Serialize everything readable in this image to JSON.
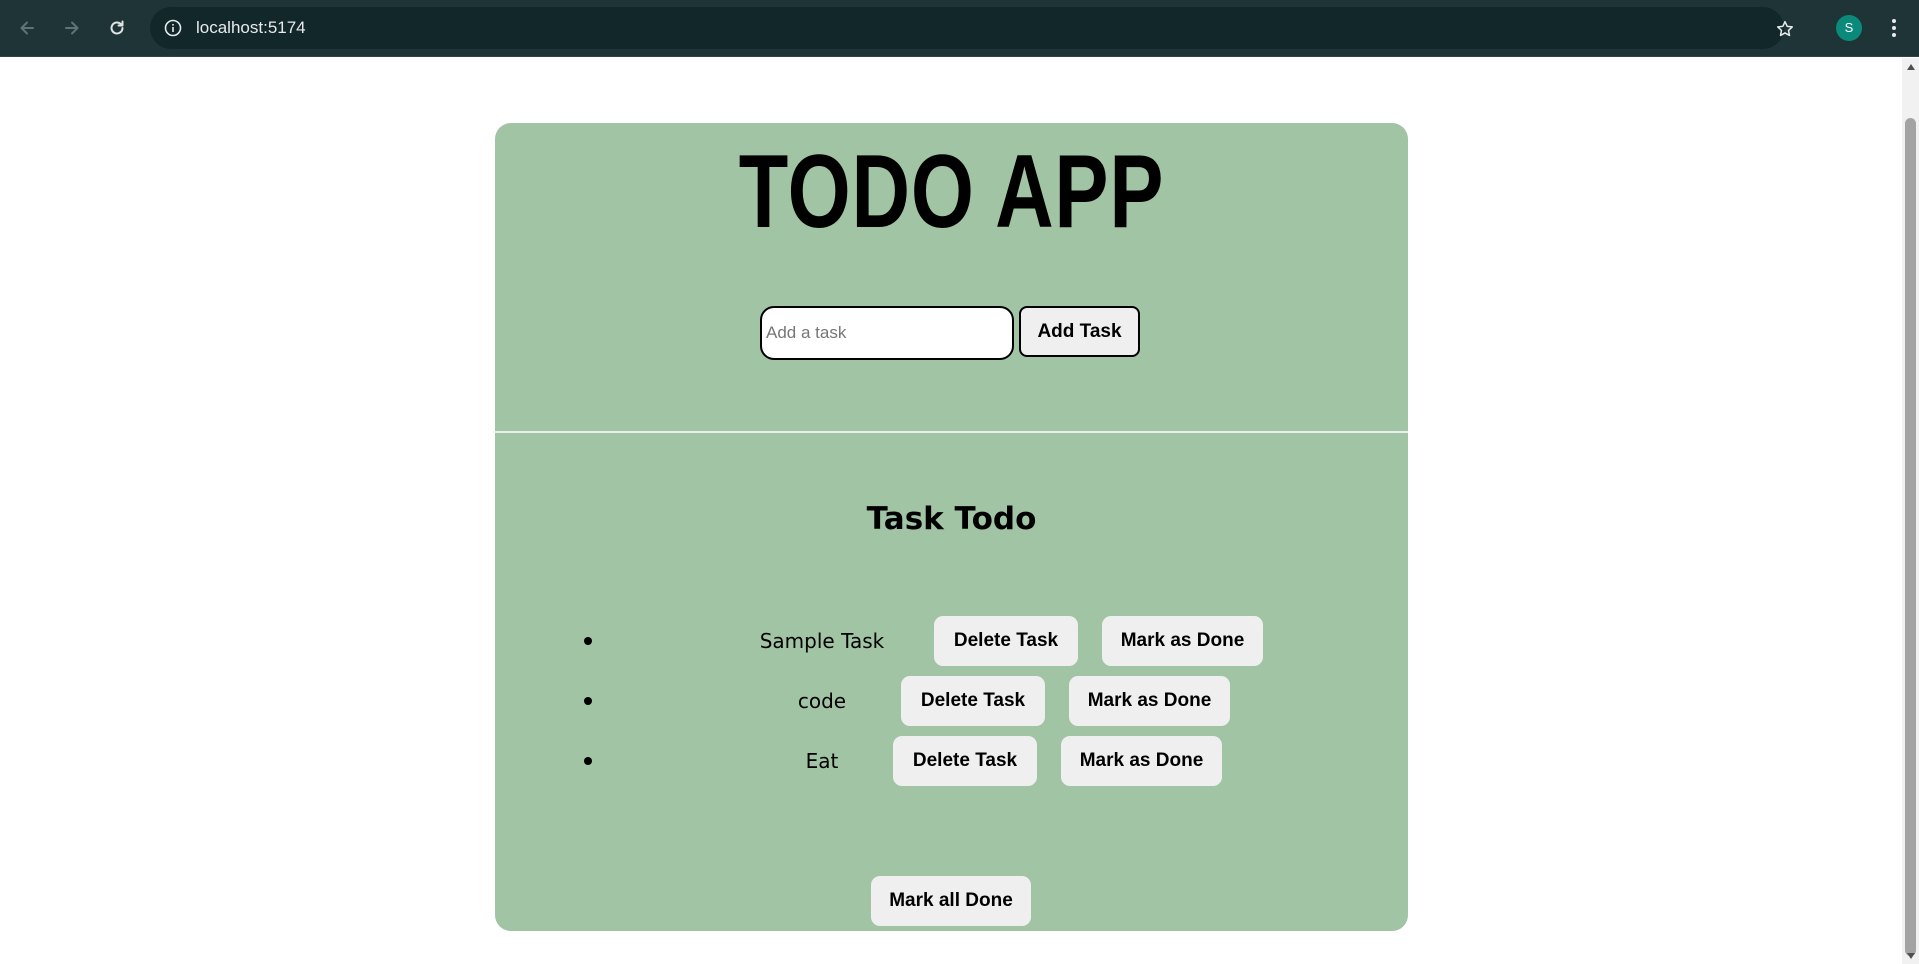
{
  "browser": {
    "url": "localhost:5174",
    "profile_initial": "S",
    "profile_color": "#0b8a7c"
  },
  "app": {
    "title": "TODO APP",
    "input_placeholder": "Add a task",
    "input_value": "",
    "add_button_label": "Add Task",
    "section_title": "Task Todo",
    "tasks": [
      {
        "text": "Sample Task",
        "delete_label": "Delete Task",
        "done_label": "Mark as Done"
      },
      {
        "text": "code",
        "delete_label": "Delete Task",
        "done_label": "Mark as Done"
      },
      {
        "text": "Eat",
        "delete_label": "Delete Task",
        "done_label": "Mark as Done"
      }
    ],
    "mark_all_label": "Mark all Done",
    "card_color": "#a0c4a4"
  }
}
